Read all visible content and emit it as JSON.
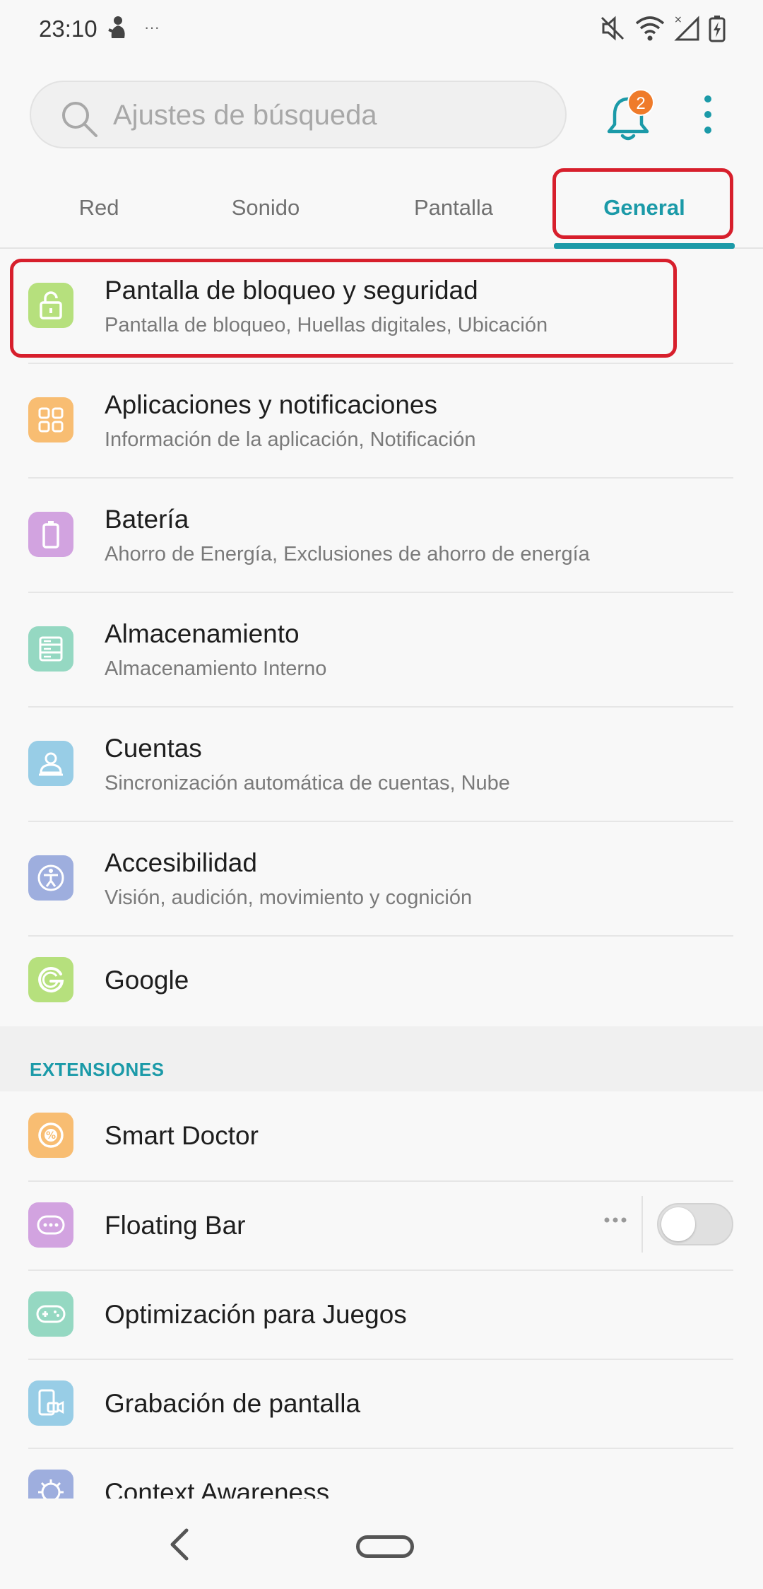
{
  "status_bar": {
    "time": "23:10",
    "notification_dots": "···"
  },
  "search": {
    "placeholder": "Ajustes de búsqueda"
  },
  "notifications": {
    "badge_count": "2"
  },
  "tabs": [
    {
      "label": "Red"
    },
    {
      "label": "Sonido"
    },
    {
      "label": "Pantalla"
    },
    {
      "label": "General"
    }
  ],
  "settings": [
    {
      "title": "Pantalla de bloqueo y seguridad",
      "subtitle": "Pantalla de bloqueo, Huellas digitales, Ubicación",
      "icon": "lock-icon",
      "color": "#b6e07d"
    },
    {
      "title": "Aplicaciones y notificaciones",
      "subtitle": "Información de la aplicación, Notificación",
      "icon": "apps-grid-icon",
      "color": "#f8bd72"
    },
    {
      "title": "Batería",
      "subtitle": "Ahorro de Energía, Exclusiones de ahorro de energía",
      "icon": "battery-icon",
      "color": "#d2a3e0"
    },
    {
      "title": "Almacenamiento",
      "subtitle": "Almacenamiento Interno",
      "icon": "storage-icon",
      "color": "#95d8c2"
    },
    {
      "title": "Cuentas",
      "subtitle": "Sincronización automática de cuentas, Nube",
      "icon": "account-icon",
      "color": "#98cde6"
    },
    {
      "title": "Accesibilidad",
      "subtitle": "Visión, audición, movimiento y cognición",
      "icon": "accessibility-icon",
      "color": "#9eaede"
    },
    {
      "title": "Google",
      "subtitle": "",
      "icon": "google-icon",
      "color": "#b6e07d"
    }
  ],
  "extensions_section": {
    "label": "EXTENSIONES"
  },
  "extensions": [
    {
      "title": "Smart Doctor",
      "icon": "smart-doctor-icon",
      "color": "#f8bd72"
    },
    {
      "title": "Floating Bar",
      "icon": "floating-bar-icon",
      "color": "#d2a3e0",
      "toggle_on": false
    },
    {
      "title": "Optimización para Juegos",
      "icon": "game-controller-icon",
      "color": "#95d8c2"
    },
    {
      "title": "Grabación de pantalla",
      "icon": "screen-record-icon",
      "color": "#98cde6"
    },
    {
      "title": "Context Awareness",
      "icon": "context-awareness-icon",
      "color": "#9eaede"
    }
  ],
  "colors": {
    "accent": "#1b9aa8",
    "highlight_box": "#d71f2c",
    "badge": "#ef7b2a"
  }
}
